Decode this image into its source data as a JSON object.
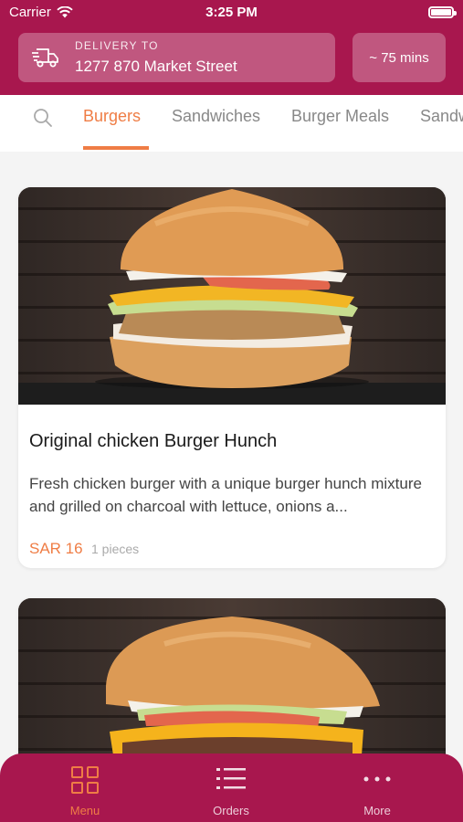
{
  "status_bar": {
    "carrier": "Carrier",
    "time": "3:25 PM"
  },
  "header": {
    "delivery_label": "DELIVERY TO",
    "delivery_address": "1277 870 Market Street",
    "eta": "~ 75 mins"
  },
  "tabs": [
    {
      "label": "Burgers",
      "active": true
    },
    {
      "label": "Sandwiches",
      "active": false
    },
    {
      "label": "Burger Meals",
      "active": false
    },
    {
      "label": "Sandw",
      "active": false
    }
  ],
  "items": [
    {
      "title": "Original chicken Burger Hunch",
      "description": "Fresh chicken burger with a unique burger hunch mixture and grilled on charcoal with lettuce, onions a...",
      "price": "SAR 16",
      "pieces": "1 pieces"
    }
  ],
  "bottom_nav": [
    {
      "label": "Menu",
      "icon": "grid-icon",
      "active": true
    },
    {
      "label": "Orders",
      "icon": "list-icon",
      "active": false
    },
    {
      "label": "More",
      "icon": "more-dots-icon",
      "active": false
    }
  ],
  "colors": {
    "brand": "#a8174e",
    "accent": "#ef7d45"
  }
}
